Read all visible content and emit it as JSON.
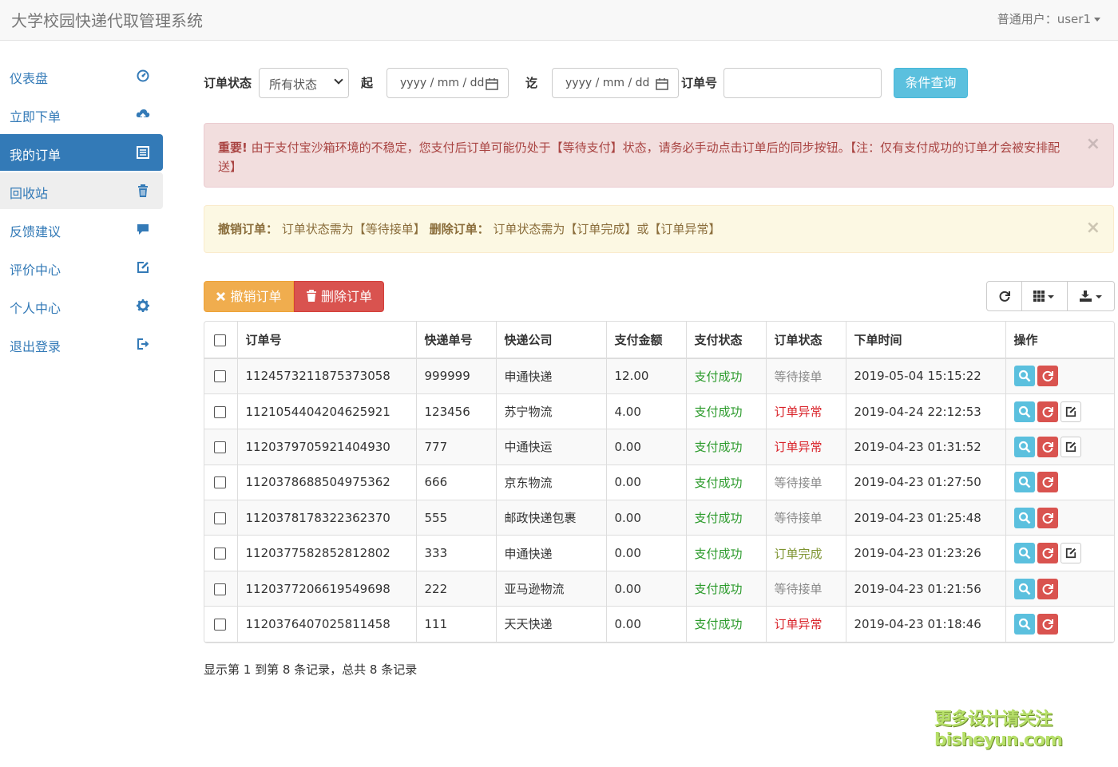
{
  "app": {
    "title": "大学校园快递代取管理系统",
    "user_menu": "普通用户：user1"
  },
  "sidebar": {
    "items": [
      {
        "label": "仪表盘",
        "icon": "dashboard-icon"
      },
      {
        "label": "立即下单",
        "icon": "cloud-upload-icon"
      },
      {
        "label": "我的订单",
        "icon": "list-alt-icon",
        "state": "active"
      },
      {
        "label": "回收站",
        "icon": "trash-icon",
        "state": "hover"
      },
      {
        "label": "反馈建议",
        "icon": "comment-icon"
      },
      {
        "label": "评价中心",
        "icon": "edit-icon"
      },
      {
        "label": "个人中心",
        "icon": "cog-icon"
      },
      {
        "label": "退出登录",
        "icon": "log-out-icon"
      }
    ]
  },
  "search": {
    "status_label": "订单状态",
    "status_value": "所有状态",
    "from_label": "起",
    "from_placeholder": "yyyy / mm / dd",
    "to_label": "讫",
    "to_placeholder": "yyyy / mm / dd",
    "order_no_label": "订单号",
    "order_no_value": "",
    "submit_label": "条件查询"
  },
  "alerts": {
    "danger": {
      "strong": "重要!",
      "text": " 由于支付宝沙箱环境的不稳定，您支付后订单可能仍处于【等待支付】状态，请务必手动点击订单后的同步按钮。【注：仅有支付成功的订单才会被安排配送】",
      "close": "×"
    },
    "warning": {
      "strong1": "撤销订单：",
      "text1": " 订单状态需为【等待接单】 ",
      "strong2": "删除订单：",
      "text2": " 订单状态需为【订单完成】或【订单异常】",
      "close": "×"
    }
  },
  "toolbar": {
    "cancel_label": "撤销订单",
    "delete_label": "删除订单",
    "refresh_icon": "refresh-icon",
    "columns_icon": "th-icon",
    "export_icon": "export-icon"
  },
  "table": {
    "headers": [
      "",
      "订单号",
      "快递单号",
      "快递公司",
      "支付金额",
      "支付状态",
      "订单状态",
      "下单时间",
      "操作"
    ],
    "rows": [
      {
        "order_no": "1124573211875373058",
        "tracking": "999999",
        "company": "申通快递",
        "amount": "12.00",
        "pay_status": "支付成功",
        "order_status": "等待接单",
        "status_color": "grey",
        "time": "2019-05-04 15:15:22",
        "edit": false
      },
      {
        "order_no": "1121054404204625921",
        "tracking": "123456",
        "company": "苏宁物流",
        "amount": "4.00",
        "pay_status": "支付成功",
        "order_status": "订单异常",
        "status_color": "red",
        "time": "2019-04-24 22:12:53",
        "edit": true
      },
      {
        "order_no": "1120379705921404930",
        "tracking": "777",
        "company": "中通快运",
        "amount": "0.00",
        "pay_status": "支付成功",
        "order_status": "订单异常",
        "status_color": "red",
        "time": "2019-04-23 01:31:52",
        "edit": true
      },
      {
        "order_no": "1120378688504975362",
        "tracking": "666",
        "company": "京东物流",
        "amount": "0.00",
        "pay_status": "支付成功",
        "order_status": "等待接单",
        "status_color": "grey",
        "time": "2019-04-23 01:27:50",
        "edit": false
      },
      {
        "order_no": "1120378178322362370",
        "tracking": "555",
        "company": "邮政快递包裹",
        "amount": "0.00",
        "pay_status": "支付成功",
        "order_status": "等待接单",
        "status_color": "grey",
        "time": "2019-04-23 01:25:48",
        "edit": false
      },
      {
        "order_no": "1120377582852812802",
        "tracking": "333",
        "company": "申通快递",
        "amount": "0.00",
        "pay_status": "支付成功",
        "order_status": "订单完成",
        "status_color": "olive",
        "time": "2019-04-23 01:23:26",
        "edit": true
      },
      {
        "order_no": "1120377206619549698",
        "tracking": "222",
        "company": "亚马逊物流",
        "amount": "0.00",
        "pay_status": "支付成功",
        "order_status": "等待接单",
        "status_color": "grey",
        "time": "2019-04-23 01:21:56",
        "edit": false
      },
      {
        "order_no": "1120376407025811458",
        "tracking": "111",
        "company": "天天快递",
        "amount": "0.00",
        "pay_status": "支付成功",
        "order_status": "订单异常",
        "status_color": "red",
        "time": "2019-04-23 01:18:46",
        "edit": false
      }
    ]
  },
  "pagination": {
    "summary": "显示第 1 到第 8 条记录，总共 8 条记录"
  },
  "watermark": {
    "line1": "更多设计请关注",
    "line2": "bisheyun.com"
  }
}
